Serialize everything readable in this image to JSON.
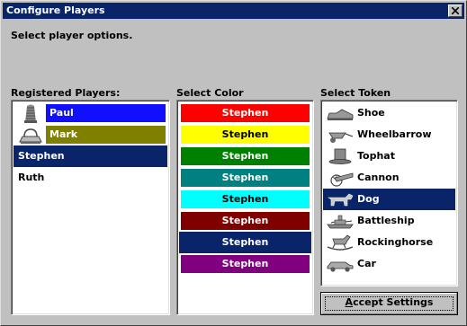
{
  "window": {
    "title": "Configure Players",
    "prompt": "Select player options."
  },
  "players": {
    "label": "Registered Players:",
    "items": [
      {
        "name": "Paul",
        "color": "#1010ff",
        "icon": "thimble-icon"
      },
      {
        "name": "Mark",
        "color": "#808000",
        "icon": "iron-icon"
      },
      {
        "name": "Stephen",
        "color": "",
        "icon": "",
        "selected": true
      },
      {
        "name": "Ruth",
        "color": "",
        "icon": ""
      }
    ]
  },
  "colors": {
    "label": "Select Color",
    "items": [
      {
        "label": "Stephen",
        "color": "#ff0000",
        "text": "#ffffff"
      },
      {
        "label": "Stephen",
        "color": "#ffff00",
        "text": "#000000"
      },
      {
        "label": "Stephen",
        "color": "#008000",
        "text": "#ffffff"
      },
      {
        "label": "Stephen",
        "color": "#008080",
        "text": "#ffffff"
      },
      {
        "label": "Stephen",
        "color": "#00ffff",
        "text": "#000000"
      },
      {
        "label": "Stephen",
        "color": "#800000",
        "text": "#ffffff"
      },
      {
        "label": "Stephen",
        "color": "#0a246a",
        "text": "#ffffff",
        "selected": true
      },
      {
        "label": "Stephen",
        "color": "#800080",
        "text": "#ffffff"
      }
    ]
  },
  "tokens": {
    "label": "Select Token",
    "items": [
      {
        "label": "Shoe",
        "icon": "shoe-icon"
      },
      {
        "label": "Wheelbarrow",
        "icon": "wheelbarrow-icon"
      },
      {
        "label": "Tophat",
        "icon": "tophat-icon"
      },
      {
        "label": "Cannon",
        "icon": "cannon-icon"
      },
      {
        "label": "Dog",
        "icon": "dog-icon",
        "selected": true
      },
      {
        "label": "Battleship",
        "icon": "battleship-icon"
      },
      {
        "label": "Rockinghorse",
        "icon": "rockinghorse-icon"
      },
      {
        "label": "Car",
        "icon": "car-icon"
      }
    ]
  },
  "buttons": {
    "accept": "Accept Settings"
  },
  "colors_theme": {
    "selection": "#0a246a",
    "title_bar": "#0a246a",
    "face": "#c0c0c0"
  }
}
